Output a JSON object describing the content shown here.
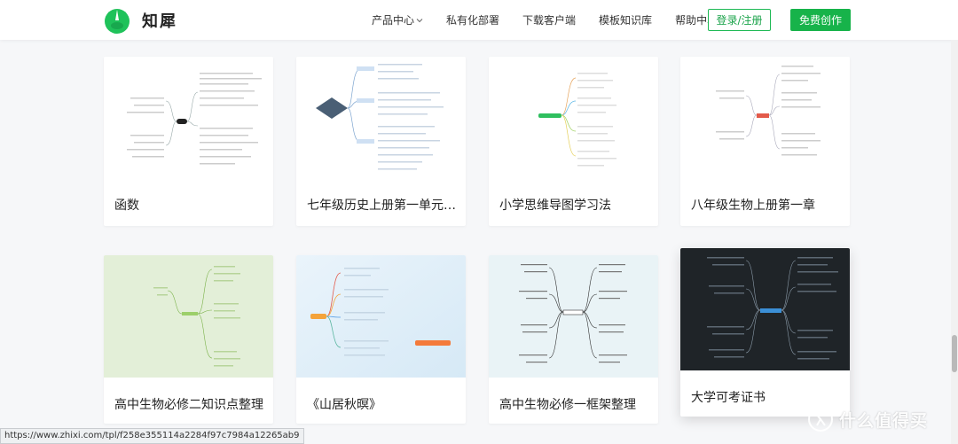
{
  "brand": {
    "name": "知犀"
  },
  "nav": {
    "items": [
      {
        "label": "产品中心"
      },
      {
        "label": "私有化部署"
      },
      {
        "label": "下载客户端"
      },
      {
        "label": "模板知识库"
      },
      {
        "label": "帮助中心"
      }
    ],
    "login_label": "登录/注册",
    "free_label": "免费创作"
  },
  "cards": [
    {
      "title": "函数"
    },
    {
      "title": "七年级历史上册第一单元史…"
    },
    {
      "title": "小学思维导图学习法"
    },
    {
      "title": "八年级生物上册第一章"
    },
    {
      "title": "高中生物必修二知识点整理"
    },
    {
      "title": "《山居秋暝》"
    },
    {
      "title": "高中生物必修一框架整理"
    },
    {
      "title": "大学可考证书"
    }
  ],
  "status_url": "https://www.zhixi.com/tpl/f258e355114a2284f97c7984a12265ab9",
  "watermark": {
    "text": "什么值得买"
  },
  "colors": {
    "brand_green": "#17b34a"
  }
}
